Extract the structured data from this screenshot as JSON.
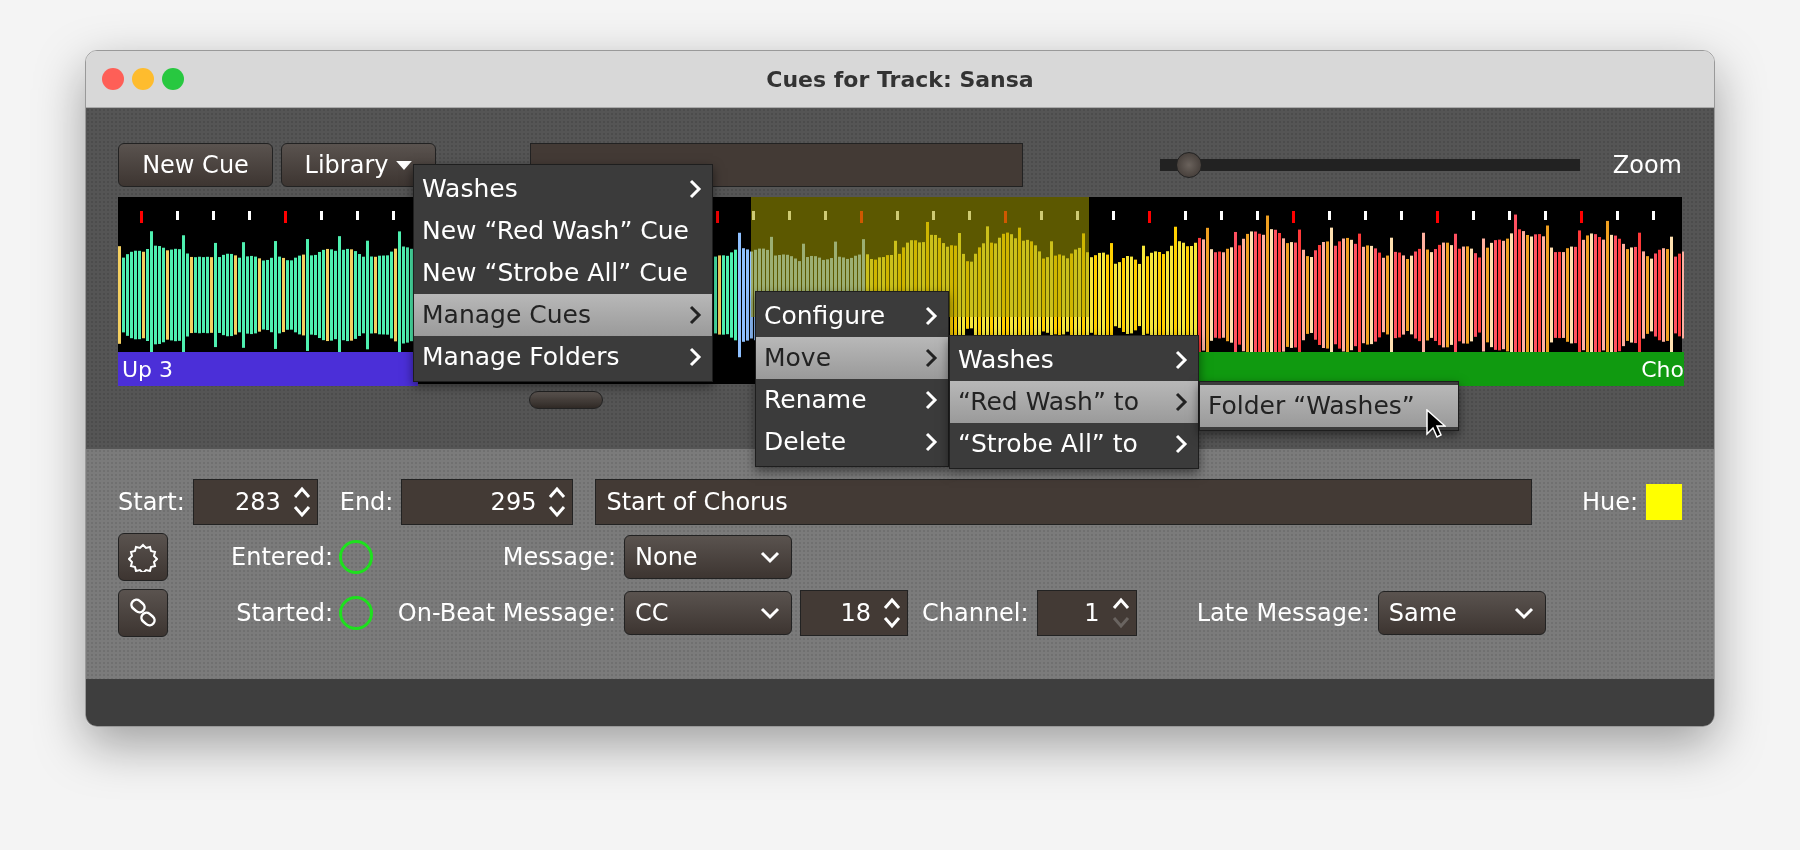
{
  "window": {
    "title": "Cues for Track: Sansa"
  },
  "toolbar": {
    "new_cue": "New Cue",
    "library": "Library",
    "zoom_label": "Zoom",
    "zoom": {
      "level": 0.04
    }
  },
  "waveform": {
    "cues": [
      {
        "label": "Up 3",
        "color": "#4b2fd8",
        "selected": false
      },
      {
        "color": "#a8a000",
        "selected": true
      },
      {
        "label": "Cho",
        "color": "#109a10",
        "selected": false
      }
    ]
  },
  "menus": [
    {
      "items": [
        {
          "label": "Washes",
          "submenu": true,
          "selected": false
        },
        {
          "label": "New “Red Wash” Cue",
          "submenu": false,
          "selected": false
        },
        {
          "label": "New “Strobe All” Cue",
          "submenu": false,
          "selected": false
        },
        {
          "label": "Manage Cues",
          "submenu": true,
          "selected": true
        },
        {
          "label": "Manage Folders",
          "submenu": true,
          "selected": false
        }
      ]
    },
    {
      "items": [
        {
          "label": "Configure",
          "submenu": true,
          "selected": false
        },
        {
          "label": "Move",
          "submenu": true,
          "selected": true
        },
        {
          "label": "Rename",
          "submenu": true,
          "selected": false
        },
        {
          "label": "Delete",
          "submenu": true,
          "selected": false
        }
      ]
    },
    {
      "items": [
        {
          "label": "Washes",
          "submenu": true,
          "selected": false
        },
        {
          "label": "“Red Wash” to",
          "submenu": true,
          "selected": true
        },
        {
          "label": "“Strobe All” to",
          "submenu": true,
          "selected": false
        }
      ]
    },
    {
      "items": [
        {
          "label": "Folder “Washes”",
          "submenu": false,
          "selected": true
        }
      ]
    }
  ],
  "cue_editor": {
    "start_label": "Start:",
    "start": "283",
    "end_label": "End:",
    "end": "295",
    "name": "Start of Chorus",
    "hue_label": "Hue:",
    "hue": {
      "color": "#ffff00"
    },
    "entered_label": "Entered:",
    "entered": {
      "active": false
    },
    "message_label": "Message:",
    "message": "None",
    "started_label": "Started:",
    "started": {
      "active": false
    },
    "on_beat_label": "On-Beat Message:",
    "on_beat": "CC",
    "note": "18",
    "channel_label": "Channel:",
    "channel": "1",
    "channel_down_disabled": true,
    "late_label": "Late Message:",
    "late": "Same"
  }
}
